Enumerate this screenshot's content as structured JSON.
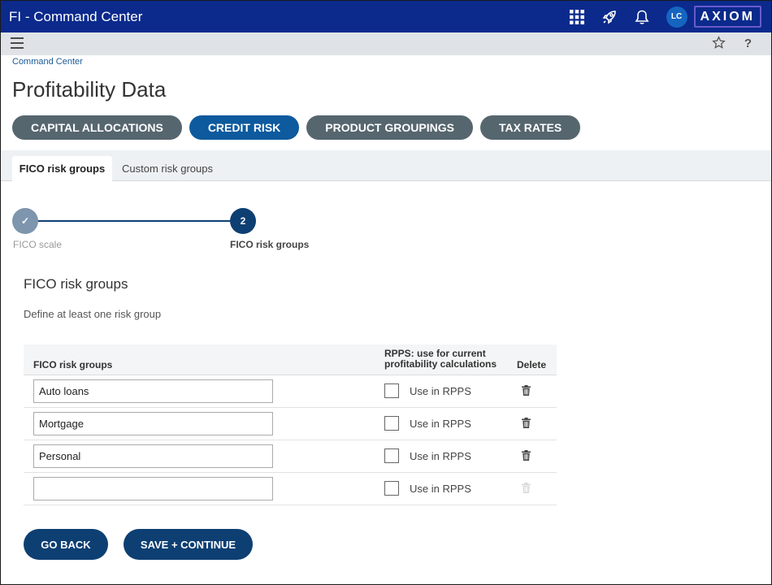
{
  "header": {
    "app_title": "FI - Command Center",
    "user_initials": "LC",
    "logo_text": "AXIOM",
    "icons": [
      "apps-grid-icon",
      "rocket-icon",
      "bell-icon"
    ]
  },
  "subbar": {
    "icons": [
      "hamburger-menu-icon",
      "star-icon",
      "help-icon"
    ],
    "help_glyph": "?"
  },
  "breadcrumb": "Command Center",
  "page_title": "Profitability Data",
  "section_pills": [
    {
      "label": "CAPITAL ALLOCATIONS",
      "active": false
    },
    {
      "label": "CREDIT RISK",
      "active": true
    },
    {
      "label": "PRODUCT GROUPINGS",
      "active": false
    },
    {
      "label": "TAX RATES",
      "active": false
    }
  ],
  "tabs": [
    {
      "label": "FICO risk groups",
      "active": true
    },
    {
      "label": "Custom risk groups",
      "active": false
    }
  ],
  "stepper": {
    "steps": [
      {
        "label": "FICO scale",
        "state": "complete",
        "glyph": "✓"
      },
      {
        "label": "FICO risk groups",
        "state": "current",
        "glyph": "2"
      }
    ]
  },
  "section": {
    "title": "FICO risk groups",
    "description": "Define at least one risk group"
  },
  "grid": {
    "columns": {
      "name": "FICO risk groups",
      "rpps": "RPPS: use for current profitability calculations",
      "delete": "Delete"
    },
    "rows": [
      {
        "value": "Auto loans",
        "rpps_label": "Use in RPPS",
        "rpps_checked": false,
        "delete_enabled": true
      },
      {
        "value": "Mortgage",
        "rpps_label": "Use in RPPS",
        "rpps_checked": false,
        "delete_enabled": true
      },
      {
        "value": "Personal",
        "rpps_label": "Use in RPPS",
        "rpps_checked": false,
        "delete_enabled": true
      },
      {
        "value": "",
        "rpps_label": "Use in RPPS",
        "rpps_checked": false,
        "delete_enabled": false
      }
    ]
  },
  "actions": {
    "back_label": "GO BACK",
    "save_label": "SAVE + CONTINUE"
  },
  "colors": {
    "topbar": "#0b2a8c",
    "pill_active": "#0d5a9e",
    "pill_inactive": "#56666f",
    "primary_button": "#0d3f73"
  }
}
